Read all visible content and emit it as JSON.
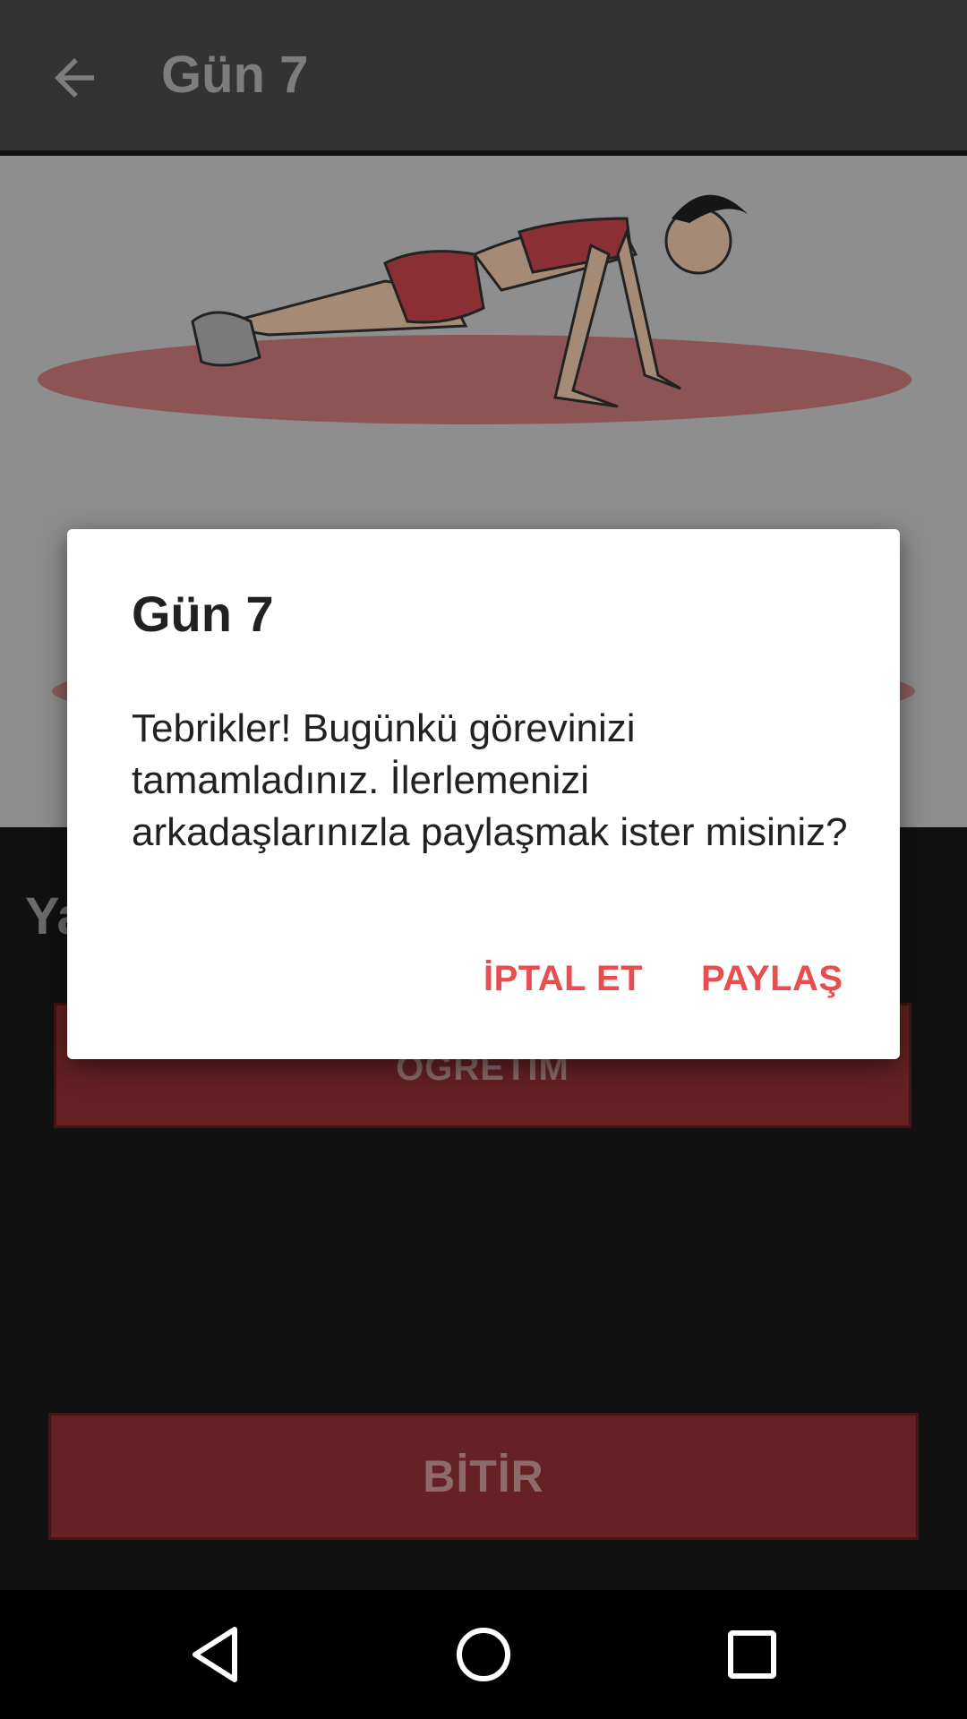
{
  "appbar": {
    "title": "Gün 7"
  },
  "content": {
    "section_heading": "Ya",
    "tutorial_button": "ÖĞRETİM",
    "finish_button": "BİTİR"
  },
  "dialog": {
    "title": "Gün 7",
    "message": "Tebrikler! Bugünkü görevinizi tamamladınız. İlerlemenizi arkadaşlarınızla paylaşmak ister misiniz?",
    "cancel_label": "İPTAL ET",
    "share_label": "PAYLAŞ"
  },
  "colors": {
    "accent": "#e84d4f",
    "button_bg": "#652123",
    "appbar_bg": "#333333"
  },
  "icons": {
    "back": "arrow-left-icon",
    "nav_back": "triangle-back-icon",
    "nav_home": "circle-home-icon",
    "nav_recents": "square-recents-icon"
  }
}
